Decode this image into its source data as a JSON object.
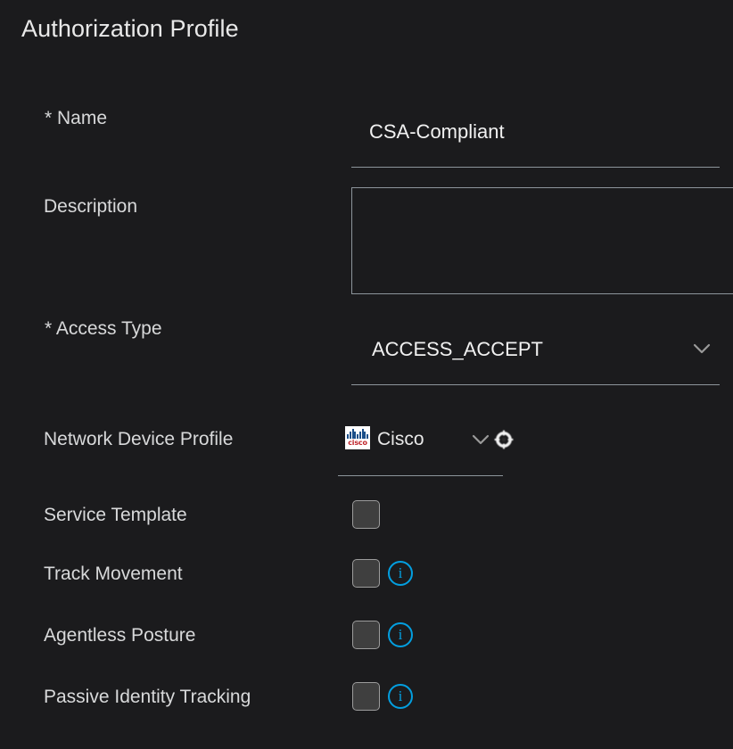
{
  "page": {
    "title": "Authorization Profile",
    "background_color": "#1b1b1d",
    "accent_color": "#039fe0"
  },
  "form": {
    "name": {
      "label": "* Name",
      "value": "CSA-Compliant",
      "placeholder": ""
    },
    "description": {
      "label": "Description",
      "value": "",
      "placeholder": ""
    },
    "access_type": {
      "label": "* Access Type",
      "value": "ACCESS_ACCEPT",
      "chevron_icon": "chevron-down-icon"
    },
    "network_device_profile": {
      "label": "Network Device Profile",
      "value": "Cisco",
      "logo_text": "cisco",
      "chevron_icon": "chevron-down-icon",
      "gear_icon": "gear-icon"
    },
    "checkbox_rows": [
      {
        "label": "Service Template",
        "checked": false,
        "has_info": false,
        "info_text": "i"
      },
      {
        "label": "Track Movement",
        "checked": false,
        "has_info": true,
        "info_text": "i"
      },
      {
        "label": "Agentless Posture",
        "checked": false,
        "has_info": true,
        "info_text": "i"
      },
      {
        "label": "Passive Identity Tracking",
        "checked": false,
        "has_info": true,
        "info_text": "i"
      }
    ]
  }
}
